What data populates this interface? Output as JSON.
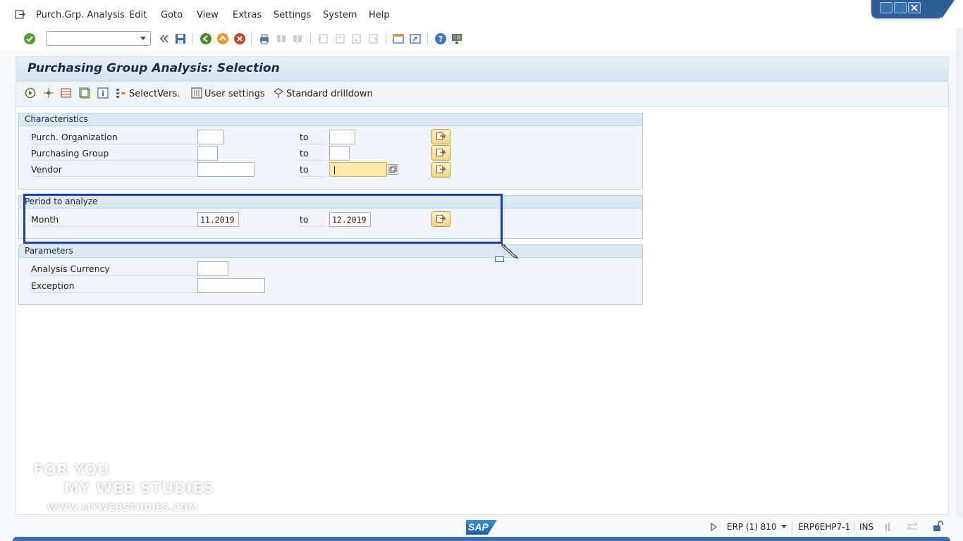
{
  "menu": {
    "items": [
      "Purch.Grp. Analysis",
      "Edit",
      "Goto",
      "View",
      "Extras",
      "Settings",
      "System",
      "Help"
    ]
  },
  "toolbar": {
    "command_value": ""
  },
  "screen": {
    "title": "Purchasing Group Analysis: Selection"
  },
  "appbar": {
    "select_vers": "SelectVers.",
    "user_settings": "User settings",
    "standard_drilldown": "Standard drilldown"
  },
  "characteristics": {
    "header": "Characteristics",
    "rows": [
      {
        "label": "Purch. Organization",
        "from": "",
        "to_label": "to",
        "to": ""
      },
      {
        "label": "Purchasing Group",
        "from": "",
        "to_label": "to",
        "to": ""
      },
      {
        "label": "Vendor",
        "from": "",
        "to_label": "to",
        "to": "|"
      }
    ]
  },
  "period": {
    "header": "Period to analyze",
    "month_label": "Month",
    "from": "11.2019",
    "to_label": "to",
    "to": "12.2019"
  },
  "parameters": {
    "header": "Parameters",
    "currency_label": "Analysis Currency",
    "currency_value": "",
    "exception_label": "Exception",
    "exception_value": ""
  },
  "watermark": {
    "line1": "FOR YOU",
    "line2": "MY WEB STUDIES",
    "line3": "WWW.MYWEBSTUDIES.COM"
  },
  "status": {
    "logo": "SAP",
    "system": "ERP (1) 810",
    "server": "ERP6EHP7-1",
    "mode": "INS"
  },
  "colors": {
    "highlight": "#1f3fb0",
    "title_bg": "#d7e5f0",
    "focus_field": "#ffe9a8"
  }
}
